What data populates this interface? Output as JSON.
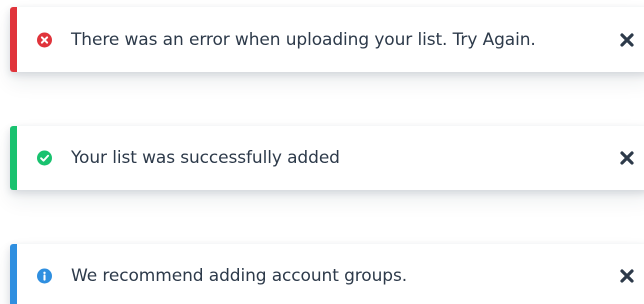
{
  "alerts": [
    {
      "type": "error",
      "message": "There was an error when uploading your list. Try Again.",
      "icon": "x-circle-icon",
      "accent_color": "#e0343b"
    },
    {
      "type": "success",
      "message": "Your list was successfully added",
      "icon": "check-circle-icon",
      "accent_color": "#19c26f"
    },
    {
      "type": "info",
      "message": "We recommend adding account groups.",
      "icon": "info-circle-icon",
      "accent_color": "#2f8fe0"
    }
  ],
  "close_icon": "close-icon",
  "text_color": "#2d3a4a"
}
